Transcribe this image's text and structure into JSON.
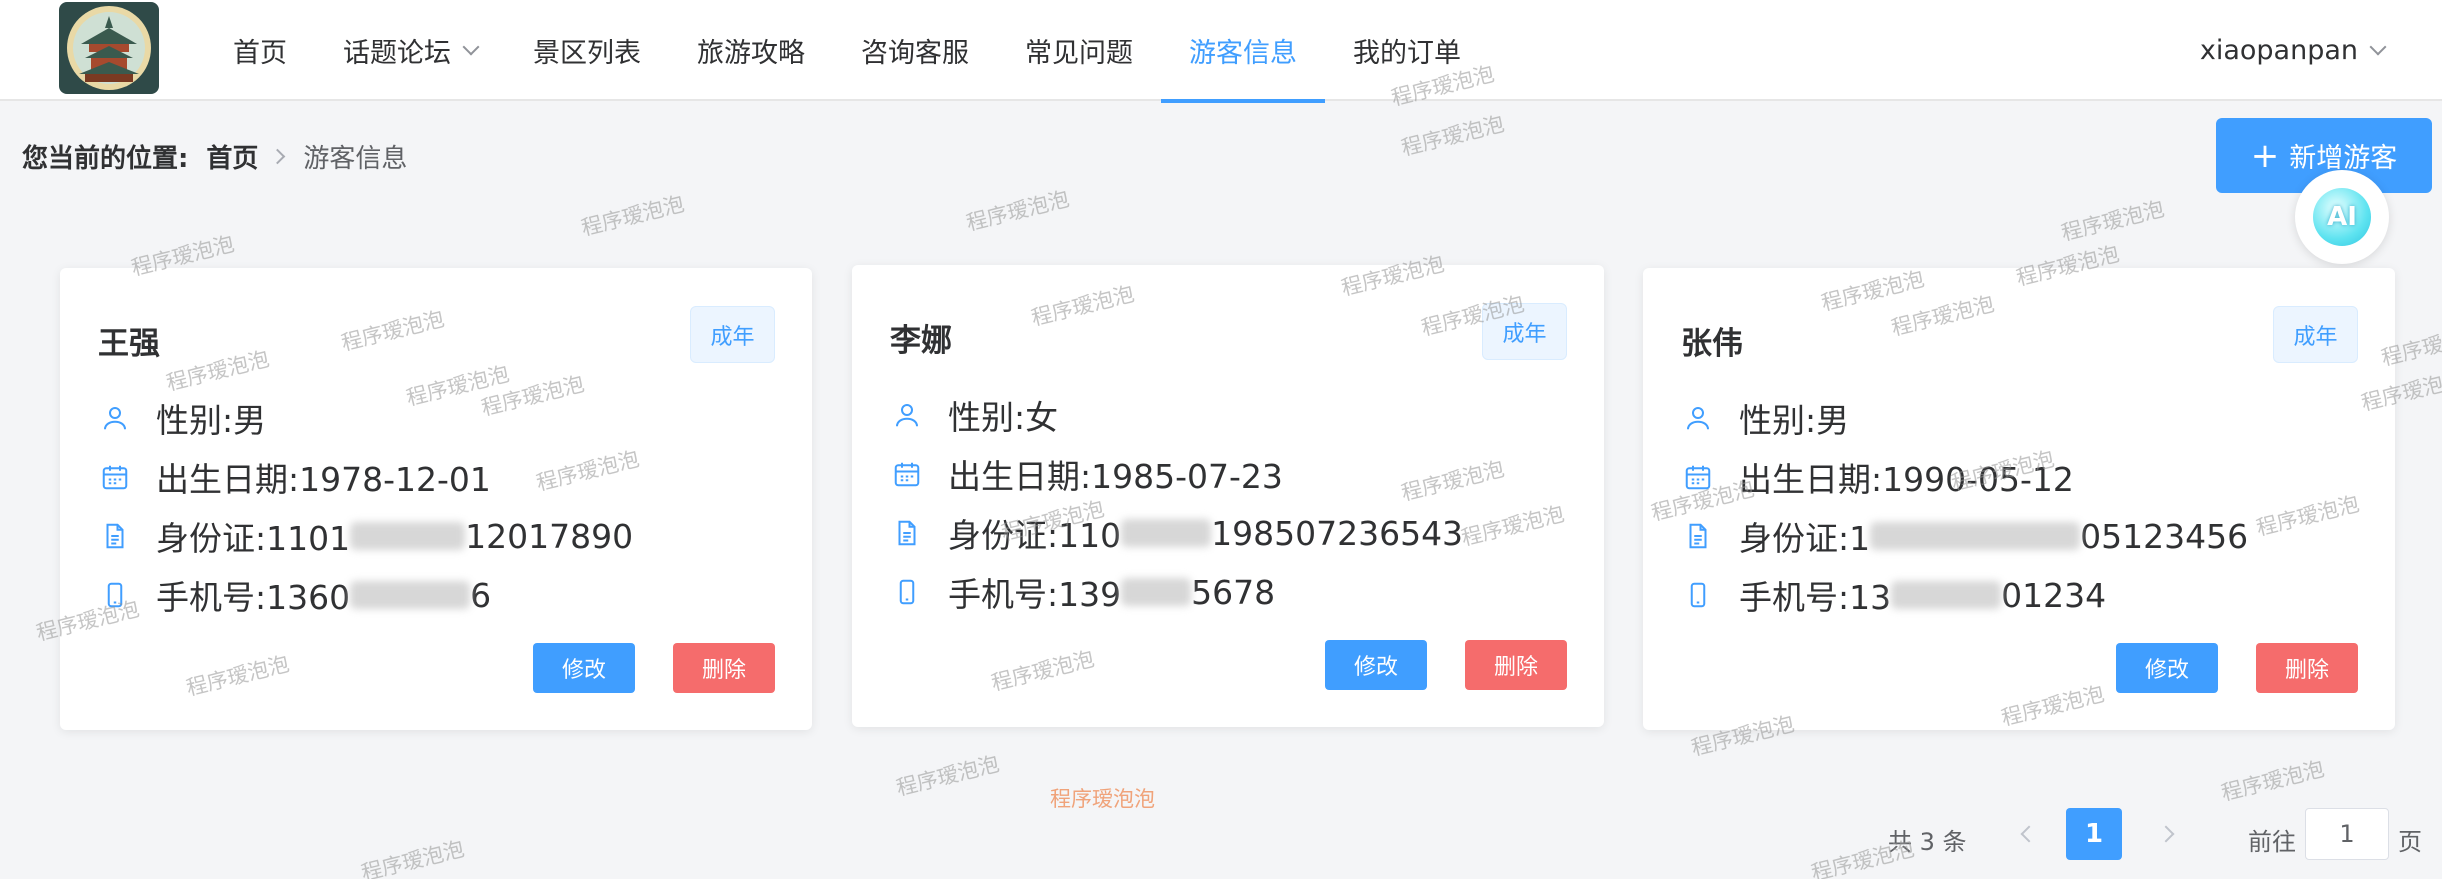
{
  "nav": {
    "items": [
      {
        "label": "首页",
        "active": false,
        "dropdown": false
      },
      {
        "label": "话题论坛",
        "active": false,
        "dropdown": true
      },
      {
        "label": "景区列表",
        "active": false,
        "dropdown": false
      },
      {
        "label": "旅游攻略",
        "active": false,
        "dropdown": false
      },
      {
        "label": "咨询客服",
        "active": false,
        "dropdown": false
      },
      {
        "label": "常见问题",
        "active": false,
        "dropdown": false
      },
      {
        "label": "游客信息",
        "active": true,
        "dropdown": false
      },
      {
        "label": "我的订单",
        "active": false,
        "dropdown": false
      }
    ],
    "user": "xiaopanpan"
  },
  "breadcrumb": {
    "label": "您当前的位置:",
    "home": "首页",
    "current": "游客信息"
  },
  "actions": {
    "add": "新增游客",
    "ai": "AI"
  },
  "cards": [
    {
      "name": "王强",
      "tag": "成年",
      "gender": "性别:男",
      "birth": "出生日期:1978-12-01",
      "id_prefix": "身份证:1101",
      "id_suffix": "12017890",
      "phone_prefix": "手机号:1360",
      "phone_suffix": "6",
      "edit": "修改",
      "delete": "删除"
    },
    {
      "name": "李娜",
      "tag": "成年",
      "gender": "性别:女",
      "birth": "出生日期:1985-07-23",
      "id_prefix": "身份证:110",
      "id_suffix": "198507236543",
      "phone_prefix": "手机号:139",
      "phone_suffix": "5678",
      "edit": "修改",
      "delete": "删除"
    },
    {
      "name": "张伟",
      "tag": "成年",
      "gender": "性别:男",
      "birth": "出生日期:1990-05-12",
      "id_prefix": "身份证:1",
      "id_suffix": "05123456",
      "phone_prefix": "手机号:13",
      "phone_suffix": "01234",
      "edit": "修改",
      "delete": "删除"
    }
  ],
  "pagination": {
    "total": "共 3 条",
    "current": "1",
    "goto": "前往",
    "unit": "页",
    "input": "1"
  },
  "watermark": "程序瑷泡泡",
  "colors": {
    "primary": "#409eff",
    "danger": "#f56c6c",
    "tag_bg": "#ecf5ff"
  }
}
